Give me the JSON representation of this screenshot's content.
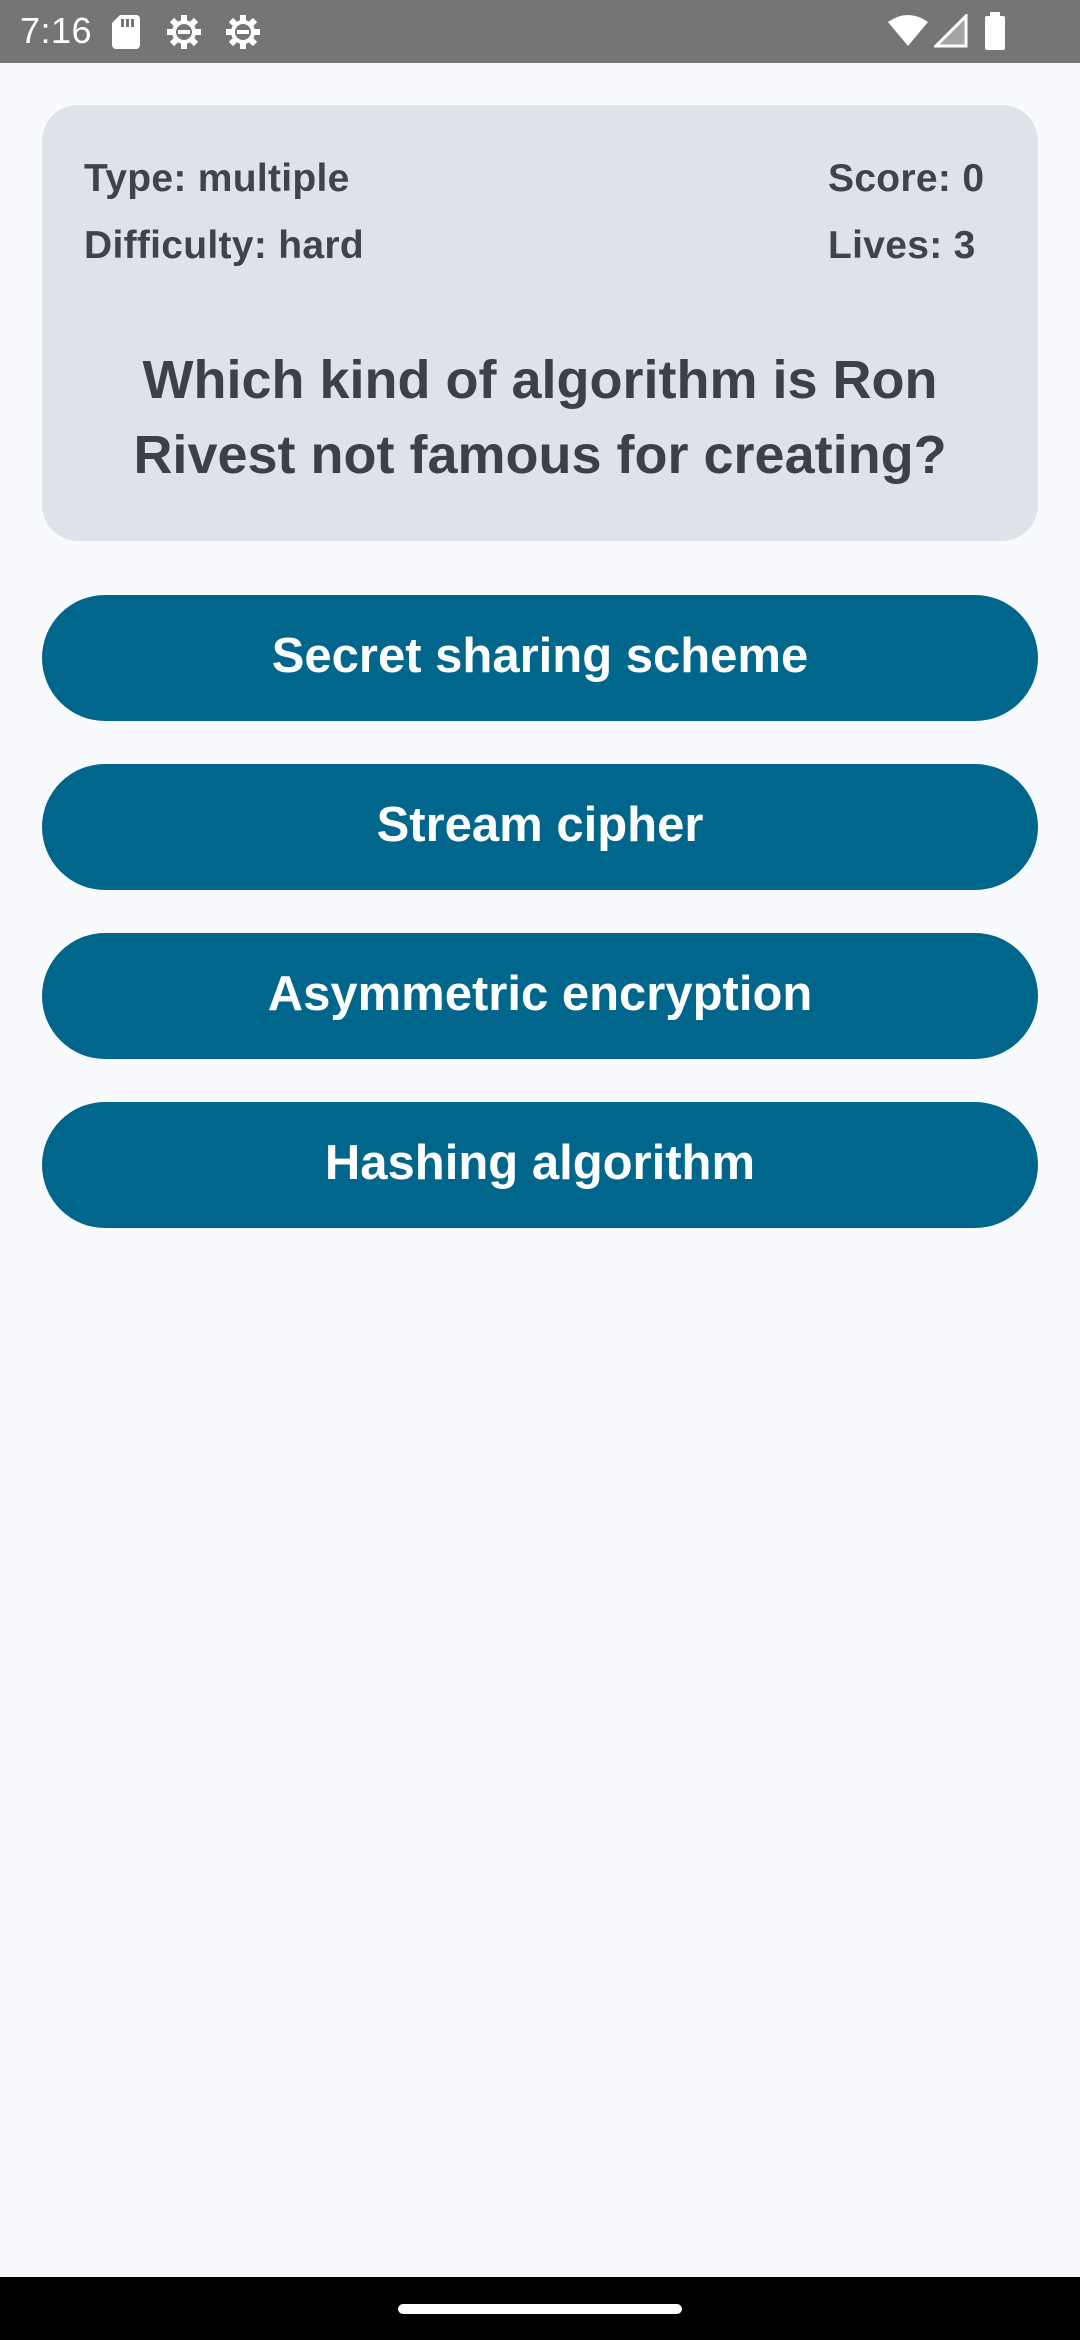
{
  "status_bar": {
    "time": "7:16",
    "icons_left": [
      "sd-card-icon",
      "settings-gear-icon",
      "settings-gear-icon"
    ],
    "icons_right": [
      "wifi-icon",
      "cellular-signal-icon",
      "battery-icon"
    ]
  },
  "quiz": {
    "type_label": "Type: multiple",
    "difficulty_label": "Difficulty: hard",
    "score_label": "Score: 0",
    "lives_label": "Lives: 3",
    "question": "Which kind of algorithm is Ron Rivest not famous for creating?"
  },
  "answers": [
    {
      "label": "Secret sharing scheme"
    },
    {
      "label": "Stream cipher"
    },
    {
      "label": "Asymmetric encryption"
    },
    {
      "label": "Hashing algorithm"
    }
  ],
  "colors": {
    "status_bar": "#757575",
    "background": "#f8fafe",
    "card": "#dee3ea",
    "button": "#00668b",
    "button_text": "#ffffff",
    "text": "#3c4148",
    "nav_bar": "#000000"
  }
}
